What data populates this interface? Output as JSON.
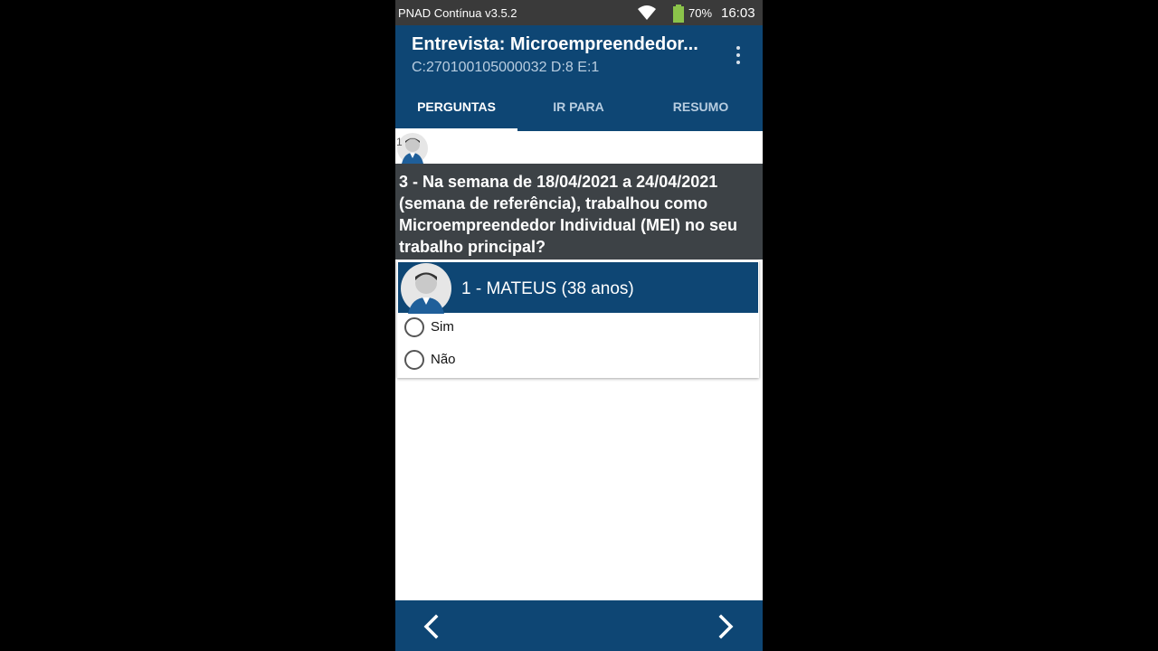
{
  "status_bar": {
    "app_label": "PNAD Contínua v3.5.2",
    "battery_pct": "70%",
    "time": "16:03",
    "icons": [
      "wifi-icon",
      "battery-icon"
    ]
  },
  "app_bar": {
    "title": "Entrevista: Microempreendedor...",
    "subtitle": "C:270100105000032 D:8 E:1",
    "menu_icon": "more-vert-icon"
  },
  "tabs": [
    {
      "label": "PERGUNTAS",
      "active": true
    },
    {
      "label": "IR PARA",
      "active": false
    },
    {
      "label": "RESUMO",
      "active": false
    }
  ],
  "member_strip": {
    "number": "1"
  },
  "question": {
    "text": "3 - Na semana de 18/04/2021 a 24/04/2021 (semana de referência), trabalhou como Microempreendedor Individual (MEI) no seu trabalho principal?"
  },
  "respondent": {
    "name": "1 - MATEUS (38 anos)",
    "options": [
      {
        "label": "Sim",
        "selected": false
      },
      {
        "label": "Não",
        "selected": false
      }
    ]
  },
  "bottom_nav": {
    "prev_icon": "chevron-left-icon",
    "next_icon": "chevron-right-icon"
  },
  "colors": {
    "primary": "#0e4674",
    "question_bg": "#3d4246",
    "status_bar": "#3a3a3a",
    "battery": "#8bc34a"
  }
}
